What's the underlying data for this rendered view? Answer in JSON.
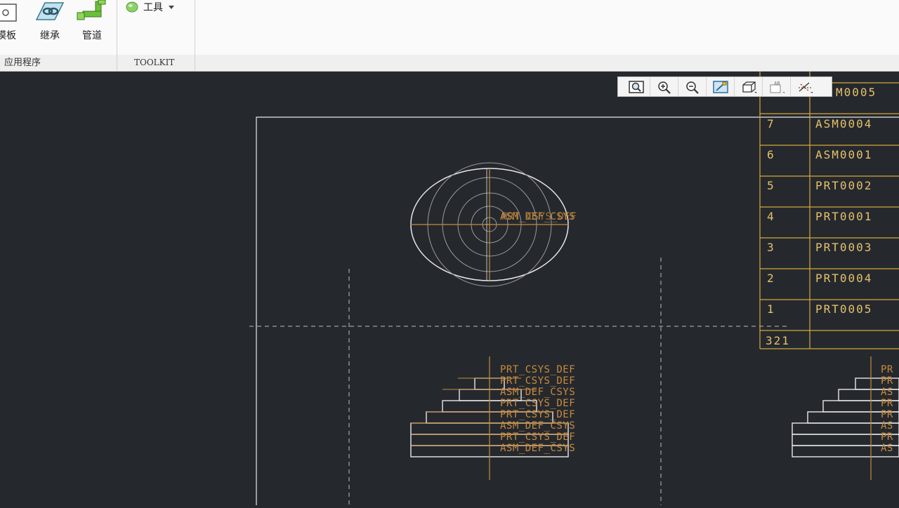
{
  "ribbon": {
    "buttons": [
      {
        "label": "模板",
        "icon": "template-icon"
      },
      {
        "label": "继承",
        "icon": "inheritance-icon"
      },
      {
        "label": "管道",
        "icon": "pipe-icon"
      }
    ],
    "tools_label": "工具",
    "groups": {
      "applications": "应用程序",
      "toolkit": "TOOLKIT"
    }
  },
  "view_toolbar": [
    "refit-icon",
    "zoom-in-icon",
    "zoom-out-icon",
    "repaint-icon",
    "display-style-icon",
    "annotation-display-icon",
    "datum-display-icon"
  ],
  "bom_table": {
    "rows": [
      {
        "index": "",
        "name": "M0005"
      },
      {
        "index": "7",
        "name": "ASM0004"
      },
      {
        "index": "6",
        "name": "ASM0001"
      },
      {
        "index": "5",
        "name": "PRT0002"
      },
      {
        "index": "4",
        "name": "PRT0001"
      },
      {
        "index": "3",
        "name": "PRT0003"
      },
      {
        "index": "2",
        "name": "PRT0004"
      },
      {
        "index": "1",
        "name": "PRT0005"
      }
    ],
    "footer": "321"
  },
  "drawing": {
    "top_view_label": "ASM_DEF_CSYS",
    "top_view_overlap_label": "PRT_CSYS_DEF",
    "front_labels": [
      "PRT_CSYS_DEF",
      "PRT_CSYS_DEF",
      "ASM_DEF_CSYS",
      "PRT_CSYS_DEF",
      "PRT_CSYS_DEF",
      "ASM_DEF_CSYS",
      "PRT_CSYS_DEF",
      "ASM_DEF_CSYS"
    ],
    "right_labels": [
      "PR",
      "PR",
      "AS",
      "PR",
      "PR",
      "AS",
      "PR",
      "AS"
    ]
  },
  "colors": {
    "canvas": "#25292e",
    "annotation": "#c98a3c",
    "table_line": "#d4a83a",
    "geometry": "#e8e8e8"
  }
}
